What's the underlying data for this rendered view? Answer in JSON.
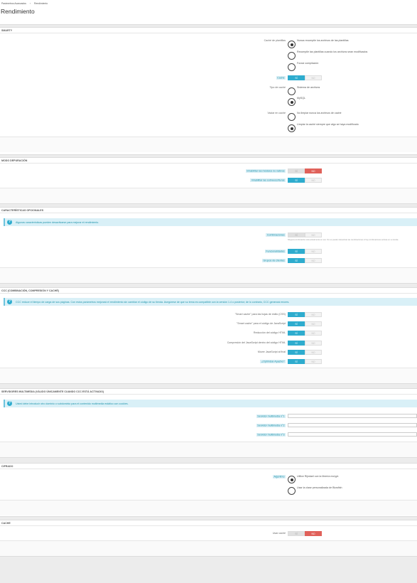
{
  "header": {
    "breadcrumb": [
      "Parámetros Avanzados",
      "Rendimiento"
    ],
    "title": "Rendimiento"
  },
  "smarty": {
    "title": "SMARTY",
    "compile_label": "Caché de plantillas",
    "compile_options": [
      "Nunca recompile los archivos de las plantillas",
      "Recompile las plantillas cuando los archivos sean modificados",
      "Forzar compilación"
    ],
    "cache_label": "Caché",
    "cache_type_label": "Tipo de caché",
    "cache_type_options": [
      "Sistema de archivos",
      "MySQL"
    ],
    "clear_label": "Vaciar en caché",
    "clear_options": [
      "No limpiar nunca los archivos de caché",
      "Limpiar la caché siempre que algo se haya modificado"
    ]
  },
  "debug": {
    "title": "MODO DEPURACIÓN",
    "disable_non_native_label": "Inhabilitar los módulos no nativos",
    "disable_overrides_label": "Inhabilitar las sobreescrituras"
  },
  "optional": {
    "title": "CARACTERÍSTICAS OPCIONALES",
    "info": "Algunas características pueden desactivarse para mejorar el rendimiento.",
    "combinations_label": "Combinaciones",
    "combinations_hint": "Ninguna combinación está actualmente en uso. No se pueden desactivar las combinaciones si hay combinaciones activas en su tienda.",
    "features_label": "Funcionalidades",
    "customer_groups_label": "Grupos de clientes"
  },
  "ccc": {
    "title": "CCC (COMBINACIÓN, COMPRESIÓN Y CACHÉ)",
    "info": "CCC reduce el tiempo de carga de sus páginas. Con estos parámetros mejorará el rendimiento sin cambiar el código de su tienda. Asegúrese de que su tema es compatible con la versión 1.4 o posterior; de lo contrario, CCC generará errores.",
    "items": [
      "\"Smart cache\" para las hojas de estilo (CSS)",
      "\"Smart cache\" para el código de JavaScript",
      "Reducción del código HTML",
      "Compresión del JavaScript dentro del código HTML",
      "Mover JavaScript al final",
      "¿Optimizar Apache?"
    ]
  },
  "media": {
    "title": "SERVIDORES MULTIMEDIA (VÁLIDO ÚNICAMENTE CUANDO CCC ESTÁ ACTIVADO)",
    "info": "Usted debe introducir otro dominio o subdominio para el contenido multimedia estático con cookies.",
    "servers": [
      "Servidor multimedia n°1",
      "Servidor multimedia n°2",
      "Servidor multimedia n°3"
    ]
  },
  "cipher": {
    "title": "CIFRADO",
    "label": "Algoritmo",
    "options": [
      "Utilice Rijndael con la librería mcrypt.",
      "Usar la clase personalizada de Blowfish"
    ]
  },
  "caching": {
    "title": "CACHE",
    "label": "Usar caché"
  },
  "switch": {
    "yes": "SÍ",
    "no": "NO"
  }
}
